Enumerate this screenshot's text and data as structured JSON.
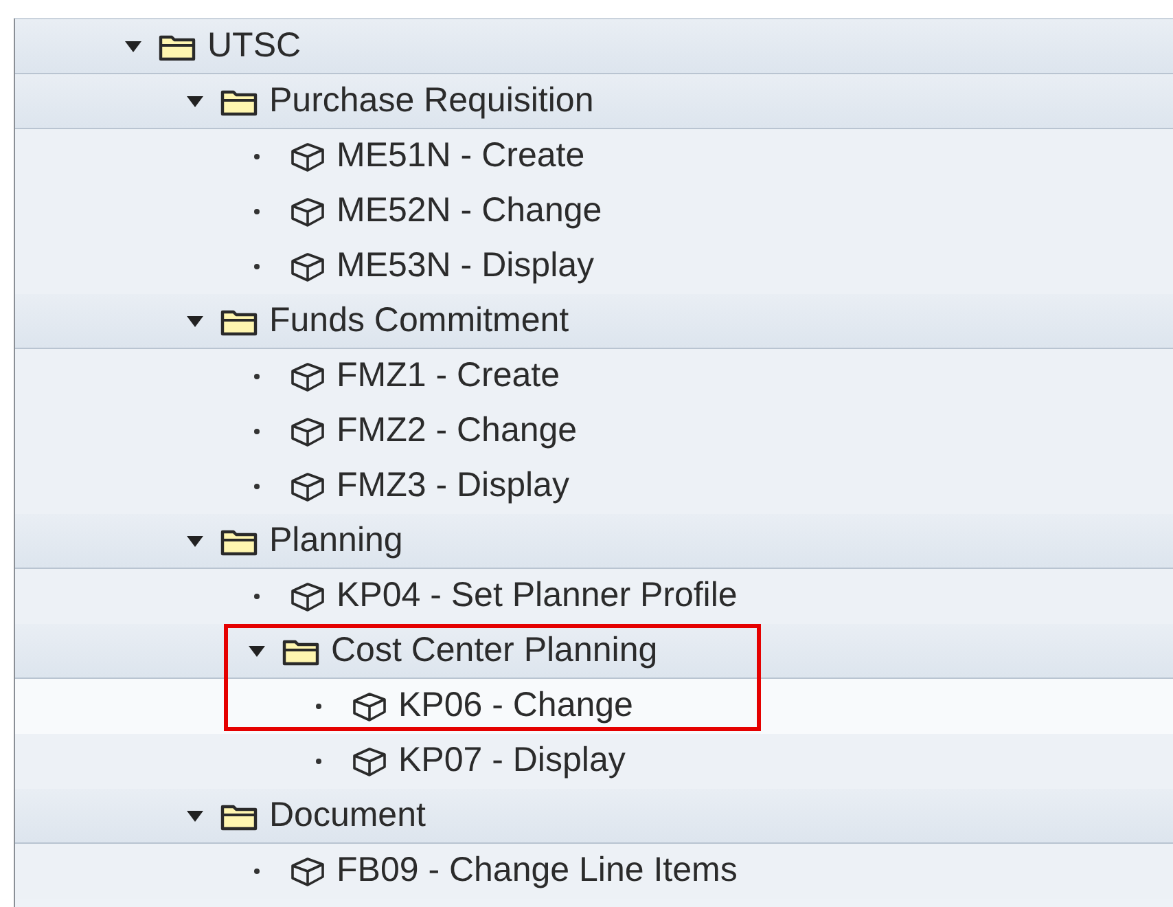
{
  "tree": [
    {
      "kind": "folder",
      "label": "UTSC",
      "expanded": true,
      "selected": false,
      "children": [
        {
          "kind": "folder",
          "label": "Purchase Requisition",
          "expanded": true,
          "selected": false,
          "children": [
            {
              "kind": "transaction",
              "label": "ME51N - Create",
              "selected": false
            },
            {
              "kind": "transaction",
              "label": "ME52N - Change",
              "selected": false
            },
            {
              "kind": "transaction",
              "label": "ME53N - Display",
              "selected": false
            }
          ]
        },
        {
          "kind": "folder",
          "label": "Funds Commitment",
          "expanded": true,
          "selected": false,
          "children": [
            {
              "kind": "transaction",
              "label": "FMZ1 - Create",
              "selected": false
            },
            {
              "kind": "transaction",
              "label": "FMZ2 - Change",
              "selected": false
            },
            {
              "kind": "transaction",
              "label": "FMZ3 - Display",
              "selected": false
            }
          ]
        },
        {
          "kind": "folder",
          "label": "Planning",
          "expanded": true,
          "selected": false,
          "children": [
            {
              "kind": "transaction",
              "label": "KP04 - Set Planner Profile",
              "selected": false
            },
            {
              "kind": "folder",
              "label": "Cost Center Planning",
              "expanded": true,
              "selected": false,
              "highlighted": true,
              "children": [
                {
                  "kind": "transaction",
                  "label": "KP06 - Change",
                  "selected": true,
                  "highlighted": true
                },
                {
                  "kind": "transaction",
                  "label": "KP07 - Display",
                  "selected": false
                }
              ]
            }
          ]
        },
        {
          "kind": "folder",
          "label": "Document",
          "expanded": true,
          "selected": false,
          "children": [
            {
              "kind": "transaction",
              "label": "FB09 - Change Line Items",
              "selected": false
            }
          ]
        }
      ]
    }
  ]
}
